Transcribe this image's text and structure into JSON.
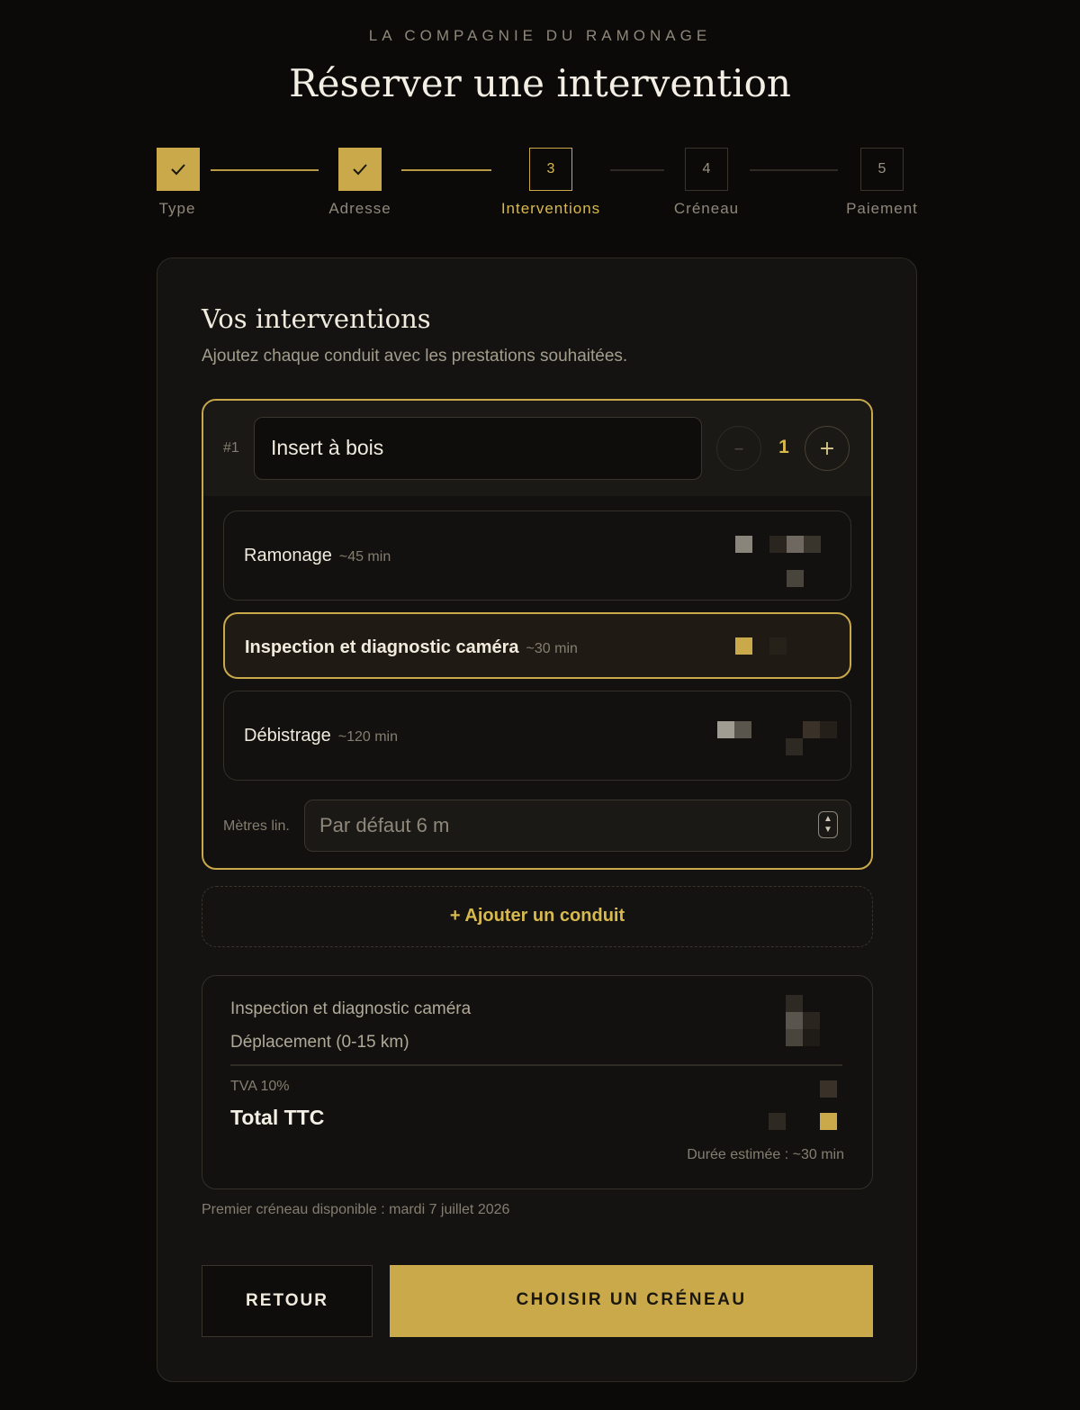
{
  "brand": "LA COMPAGNIE DU RAMONAGE",
  "title": "Réserver une intervention",
  "steps": [
    {
      "num": "1",
      "label": "Type",
      "state": "done"
    },
    {
      "num": "2",
      "label": "Adresse",
      "state": "done"
    },
    {
      "num": "3",
      "label": "Interventions",
      "state": "active"
    },
    {
      "num": "4",
      "label": "Créneau",
      "state": "todo"
    },
    {
      "num": "5",
      "label": "Paiement",
      "state": "todo"
    }
  ],
  "card": {
    "title": "Vos interventions",
    "subtitle": "Ajoutez chaque conduit avec les prestations souhaitées."
  },
  "conduit": {
    "number": "#1",
    "name": "Insert à bois",
    "quantity": "1",
    "minus": "–",
    "plus": "+",
    "services": [
      {
        "name": "Ramonage",
        "duration": "~45 min",
        "selected": false
      },
      {
        "name": "Inspection et diagnostic caméra",
        "duration": "~30 min",
        "selected": true
      },
      {
        "name": "Débistrage",
        "duration": "~120 min",
        "selected": false
      }
    ],
    "metres_label": "Mètres lin.",
    "metres_placeholder": "Par défaut 6 m"
  },
  "add_conduit": "+ Ajouter un conduit",
  "summary": {
    "lines": [
      "Inspection et diagnostic caméra",
      "Déplacement (0-15 km)"
    ],
    "tva": "TVA 10%",
    "total": "Total TTC",
    "duration": "Durée estimée : ~30 min"
  },
  "first_slot": "Premier créneau disponible : mardi 7 juillet 2026",
  "buttons": {
    "back": "RETOUR",
    "next": "CHOISIR UN CRÉNEAU"
  },
  "colors": {
    "accent": "#c9a94a",
    "background": "#0b0a09",
    "card": "#141311"
  },
  "icons": {
    "done_step": "check-icon",
    "spinner": "chevron-up-down-icon"
  }
}
